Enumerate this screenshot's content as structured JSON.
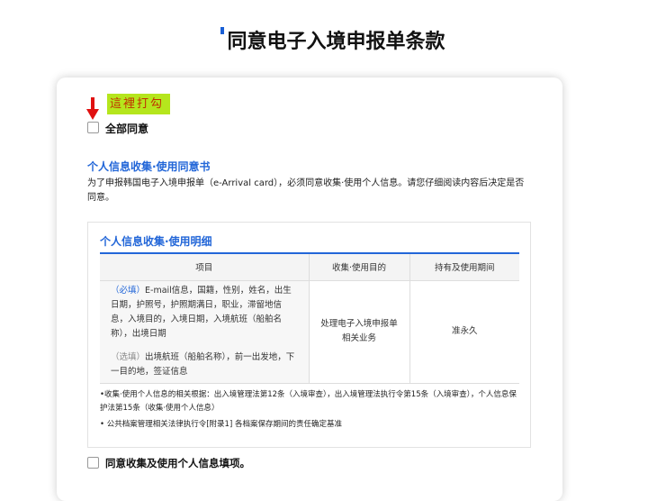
{
  "page_title": "同意电子入境申报单条款",
  "annotation": "這裡打勾",
  "agree_all_label": "全部同意",
  "consent": {
    "heading": "个人信息收集·使用同意书",
    "description": "为了申报韩国电子入境申报单（e-Arrival card），必须同意收集·使用个人信息。请您仔细阅读内容后决定是否同意。",
    "details_heading": "个人信息收集·使用明细",
    "table": {
      "headers": [
        "项目",
        "收集·使用目的",
        "持有及使用期间"
      ],
      "required_tag": "（必填）",
      "required_items": "E-mail信息，国籍，性别，姓名，出生日期，护照号，护照期满日，职业，滞留地信息，入境目的，入境日期，入境航班（船舶名称），出境日期",
      "optional_tag": "（选填）",
      "optional_items": "出境航班（船舶名称），前一出发地，下一目的地，签证信息",
      "purpose": "处理电子入境申报单相关业务",
      "period": "准永久"
    },
    "footnotes": [
      "•收集·使用个人信息的相关根据：出入境管理法第12条（入境审查），出入境管理法执行令第15条（入境审查），个人信息保护法第15条（收集·使用个人信息）",
      "• 公共档案管理相关法律执行令[附录1] 各档案保存期间的责任确定基准"
    ],
    "agree_label": "同意收集及使用个人信息填项。"
  }
}
